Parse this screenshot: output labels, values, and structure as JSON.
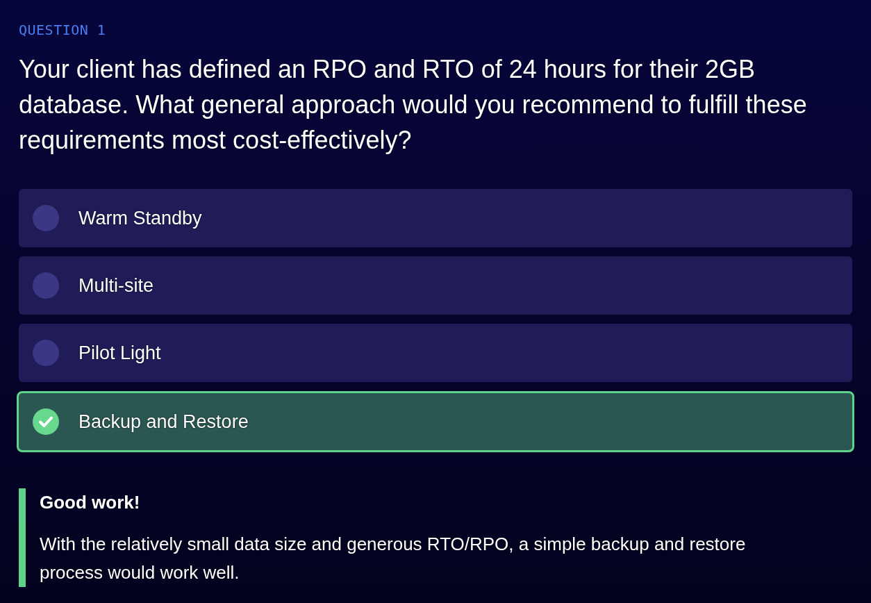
{
  "question": {
    "label": "QUESTION 1",
    "text": "Your client has defined an RPO and RTO of 24 hours for their 2GB database. What general approach would you recommend to fulfill these requirements most cost-effectively?"
  },
  "options": [
    {
      "label": "Warm Standby",
      "selected": false
    },
    {
      "label": "Multi-site",
      "selected": false
    },
    {
      "label": "Pilot Light",
      "selected": false
    },
    {
      "label": "Backup and Restore",
      "selected": true
    }
  ],
  "feedback": {
    "title": "Good work!",
    "text": "With the relatively small data size and generous RTO/RPO, a simple backup and restore process would work well."
  }
}
